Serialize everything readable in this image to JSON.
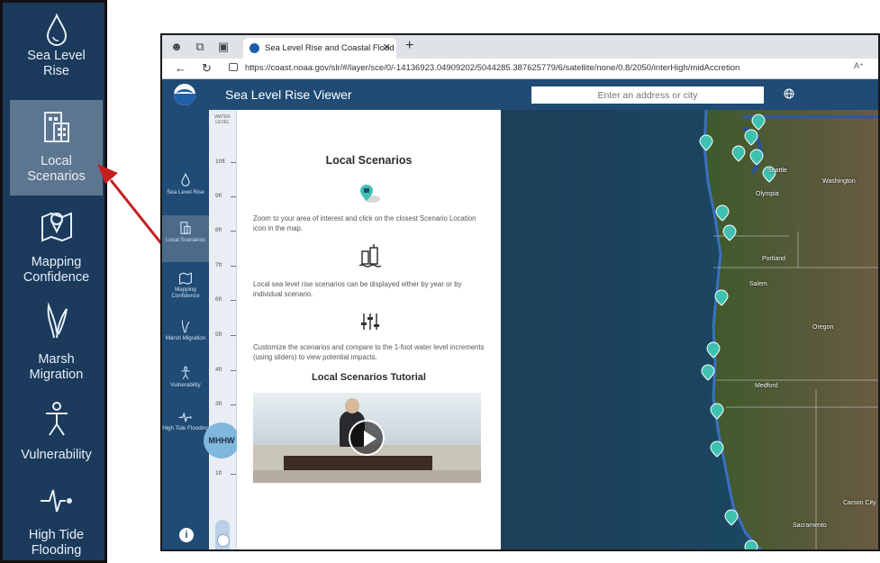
{
  "zoom_sidebar": {
    "items": [
      {
        "label": "Sea Level\nRise",
        "icon": "water-drop-icon",
        "active": false
      },
      {
        "label": "Local\nScenarios",
        "icon": "buildings-icon",
        "active": true
      },
      {
        "label": "Mapping\nConfidence",
        "icon": "map-pin-icon",
        "active": false
      },
      {
        "label": "Marsh\nMigration",
        "icon": "marsh-grass-icon",
        "active": false
      },
      {
        "label": "Vulnerability",
        "icon": "person-icon",
        "active": false
      },
      {
        "label": "High Tide\nFlooding",
        "icon": "tide-wave-icon",
        "active": false
      }
    ]
  },
  "browser": {
    "tab_title": "Sea Level Rise and Coastal Flood",
    "url": "https://coast.noaa.gov/slr/#/layer/sce/0/-14136923.04909202/5044285.387625779/6/satellite/none/0.8/2050/interHigh/midAccretion"
  },
  "app": {
    "title": "Sea Level Rise Viewer",
    "search_placeholder": "Enter an address or city"
  },
  "sidebar": {
    "items": [
      {
        "label": "Sea Level Rise",
        "icon": "water-drop-icon",
        "active": false
      },
      {
        "label": "Local Scenarios",
        "icon": "buildings-icon",
        "active": true
      },
      {
        "label": "Mapping Confidence",
        "icon": "map-pin-icon",
        "active": false
      },
      {
        "label": "Marsh Migration",
        "icon": "marsh-grass-icon",
        "active": false
      },
      {
        "label": "Vulnerability",
        "icon": "person-icon",
        "active": false
      },
      {
        "label": "High Tide Flooding",
        "icon": "tide-wave-icon",
        "active": false
      }
    ],
    "info_label": "i"
  },
  "water_level": {
    "title": "WATER LEVEL",
    "ticks": [
      "10ft",
      "9ft",
      "8ft",
      "7ft",
      "6ft",
      "5ft",
      "4ft",
      "3ft",
      "2ft",
      "1ft"
    ],
    "datum": "MHHW"
  },
  "panel": {
    "title": "Local Scenarios",
    "step1": "Zoom to your area of interest and click on the closest Scenario Location icon in the map.",
    "step2": "Local sea level rise scenarios can be displayed either by year or by individual scenario.",
    "step3": "Customize the scenarios and compare to the 1-foot water level increments (using sliders) to view potential impacts.",
    "tutorial_title": "Local Scenarios Tutorial"
  },
  "map": {
    "labels": [
      "Seattle",
      "Olympia",
      "Washington",
      "Portland",
      "Salem",
      "Oregon",
      "Medford",
      "Carson City",
      "Sacramento"
    ]
  },
  "colors": {
    "sidebar_bg": "#1f4b75",
    "active_bg": "#4c6a8a",
    "marker": "#3fc1b0",
    "arrow": "#c41f1f"
  }
}
